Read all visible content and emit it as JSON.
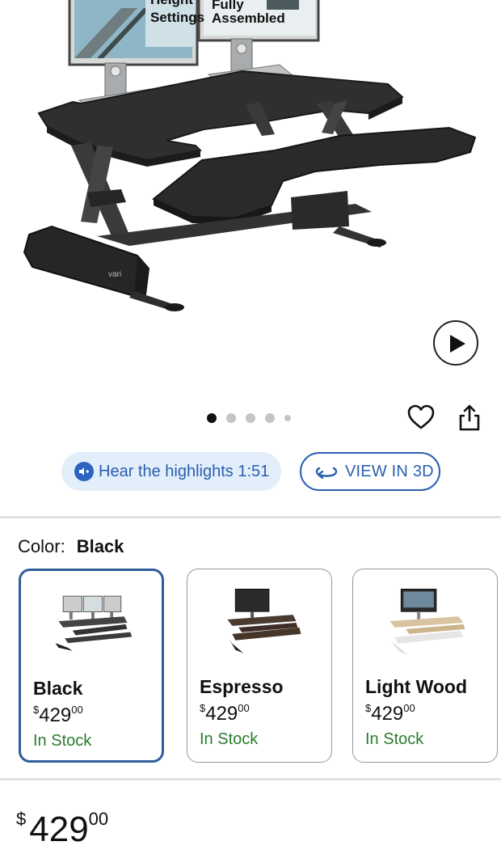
{
  "hero": {
    "monitor_left_text": [
      "Height",
      "Settings"
    ],
    "monitor_right_text": [
      "Fully",
      "Assembled"
    ],
    "brand_mark": "vari",
    "carousel": {
      "count": 5,
      "active_index": 0
    }
  },
  "audio": {
    "label": "Hear the highlights 1:51"
  },
  "view3d": {
    "label": "VIEW IN 3D"
  },
  "color": {
    "label": "Color:",
    "selected": "Black",
    "options": [
      {
        "name": "Black",
        "currency": "$",
        "price": "429",
        "cents": "00",
        "stock": "In Stock"
      },
      {
        "name": "Espresso",
        "currency": "$",
        "price": "429",
        "cents": "00",
        "stock": "In Stock"
      },
      {
        "name": "Light Wood",
        "currency": "$",
        "price": "429",
        "cents": "00",
        "stock": "In Stock"
      }
    ]
  },
  "price": {
    "currency": "$",
    "dollars": "429",
    "cents": "00"
  },
  "colors": {
    "accent": "#2a5fb0",
    "stock_green": "#2a7d2e",
    "selected_border": "#2f5d9a",
    "desk": "#2b2b2b"
  }
}
